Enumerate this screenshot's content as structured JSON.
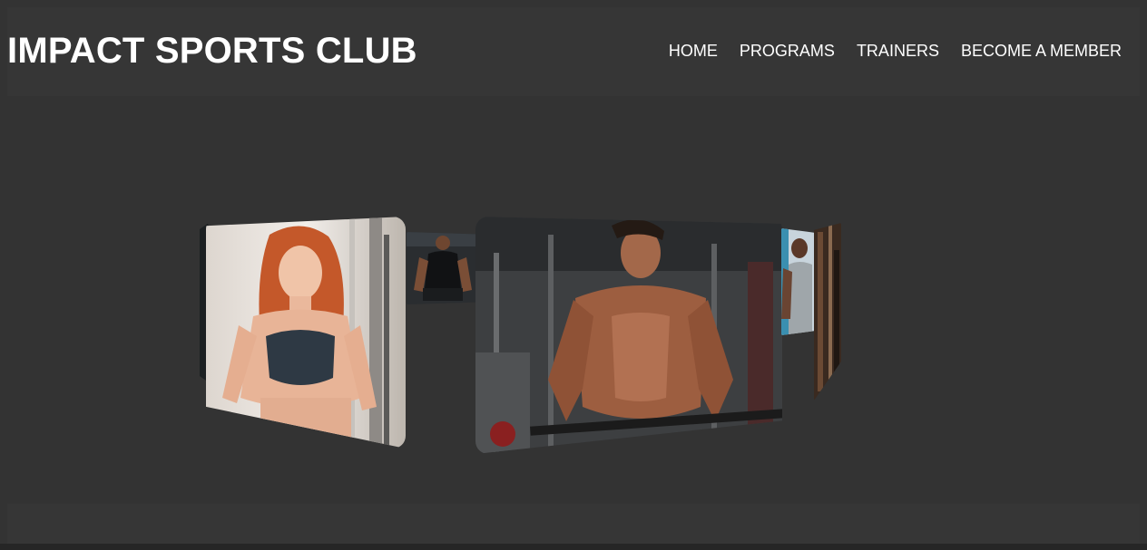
{
  "header": {
    "brand": "IMPACT SPORTS CLUB",
    "nav": [
      {
        "label": "HOME"
      },
      {
        "label": "PROGRAMS"
      },
      {
        "label": "TRAINERS"
      },
      {
        "label": "BECOME A MEMBER"
      }
    ]
  },
  "carousel": {
    "type": "3d-coverflow",
    "slides": [
      {
        "subject": "dark-image-edge"
      },
      {
        "subject": "red-haired-woman-in-sports-bra"
      },
      {
        "subject": "man-in-black-tank-top-seated"
      },
      {
        "subject": "muscular-man-barbell-curl"
      },
      {
        "subject": "trainer-in-grey-tank-top"
      },
      {
        "subject": "gym-interior-edge"
      }
    ]
  },
  "colors": {
    "background": "#333333",
    "header": "#363636",
    "text": "#ffffff"
  }
}
